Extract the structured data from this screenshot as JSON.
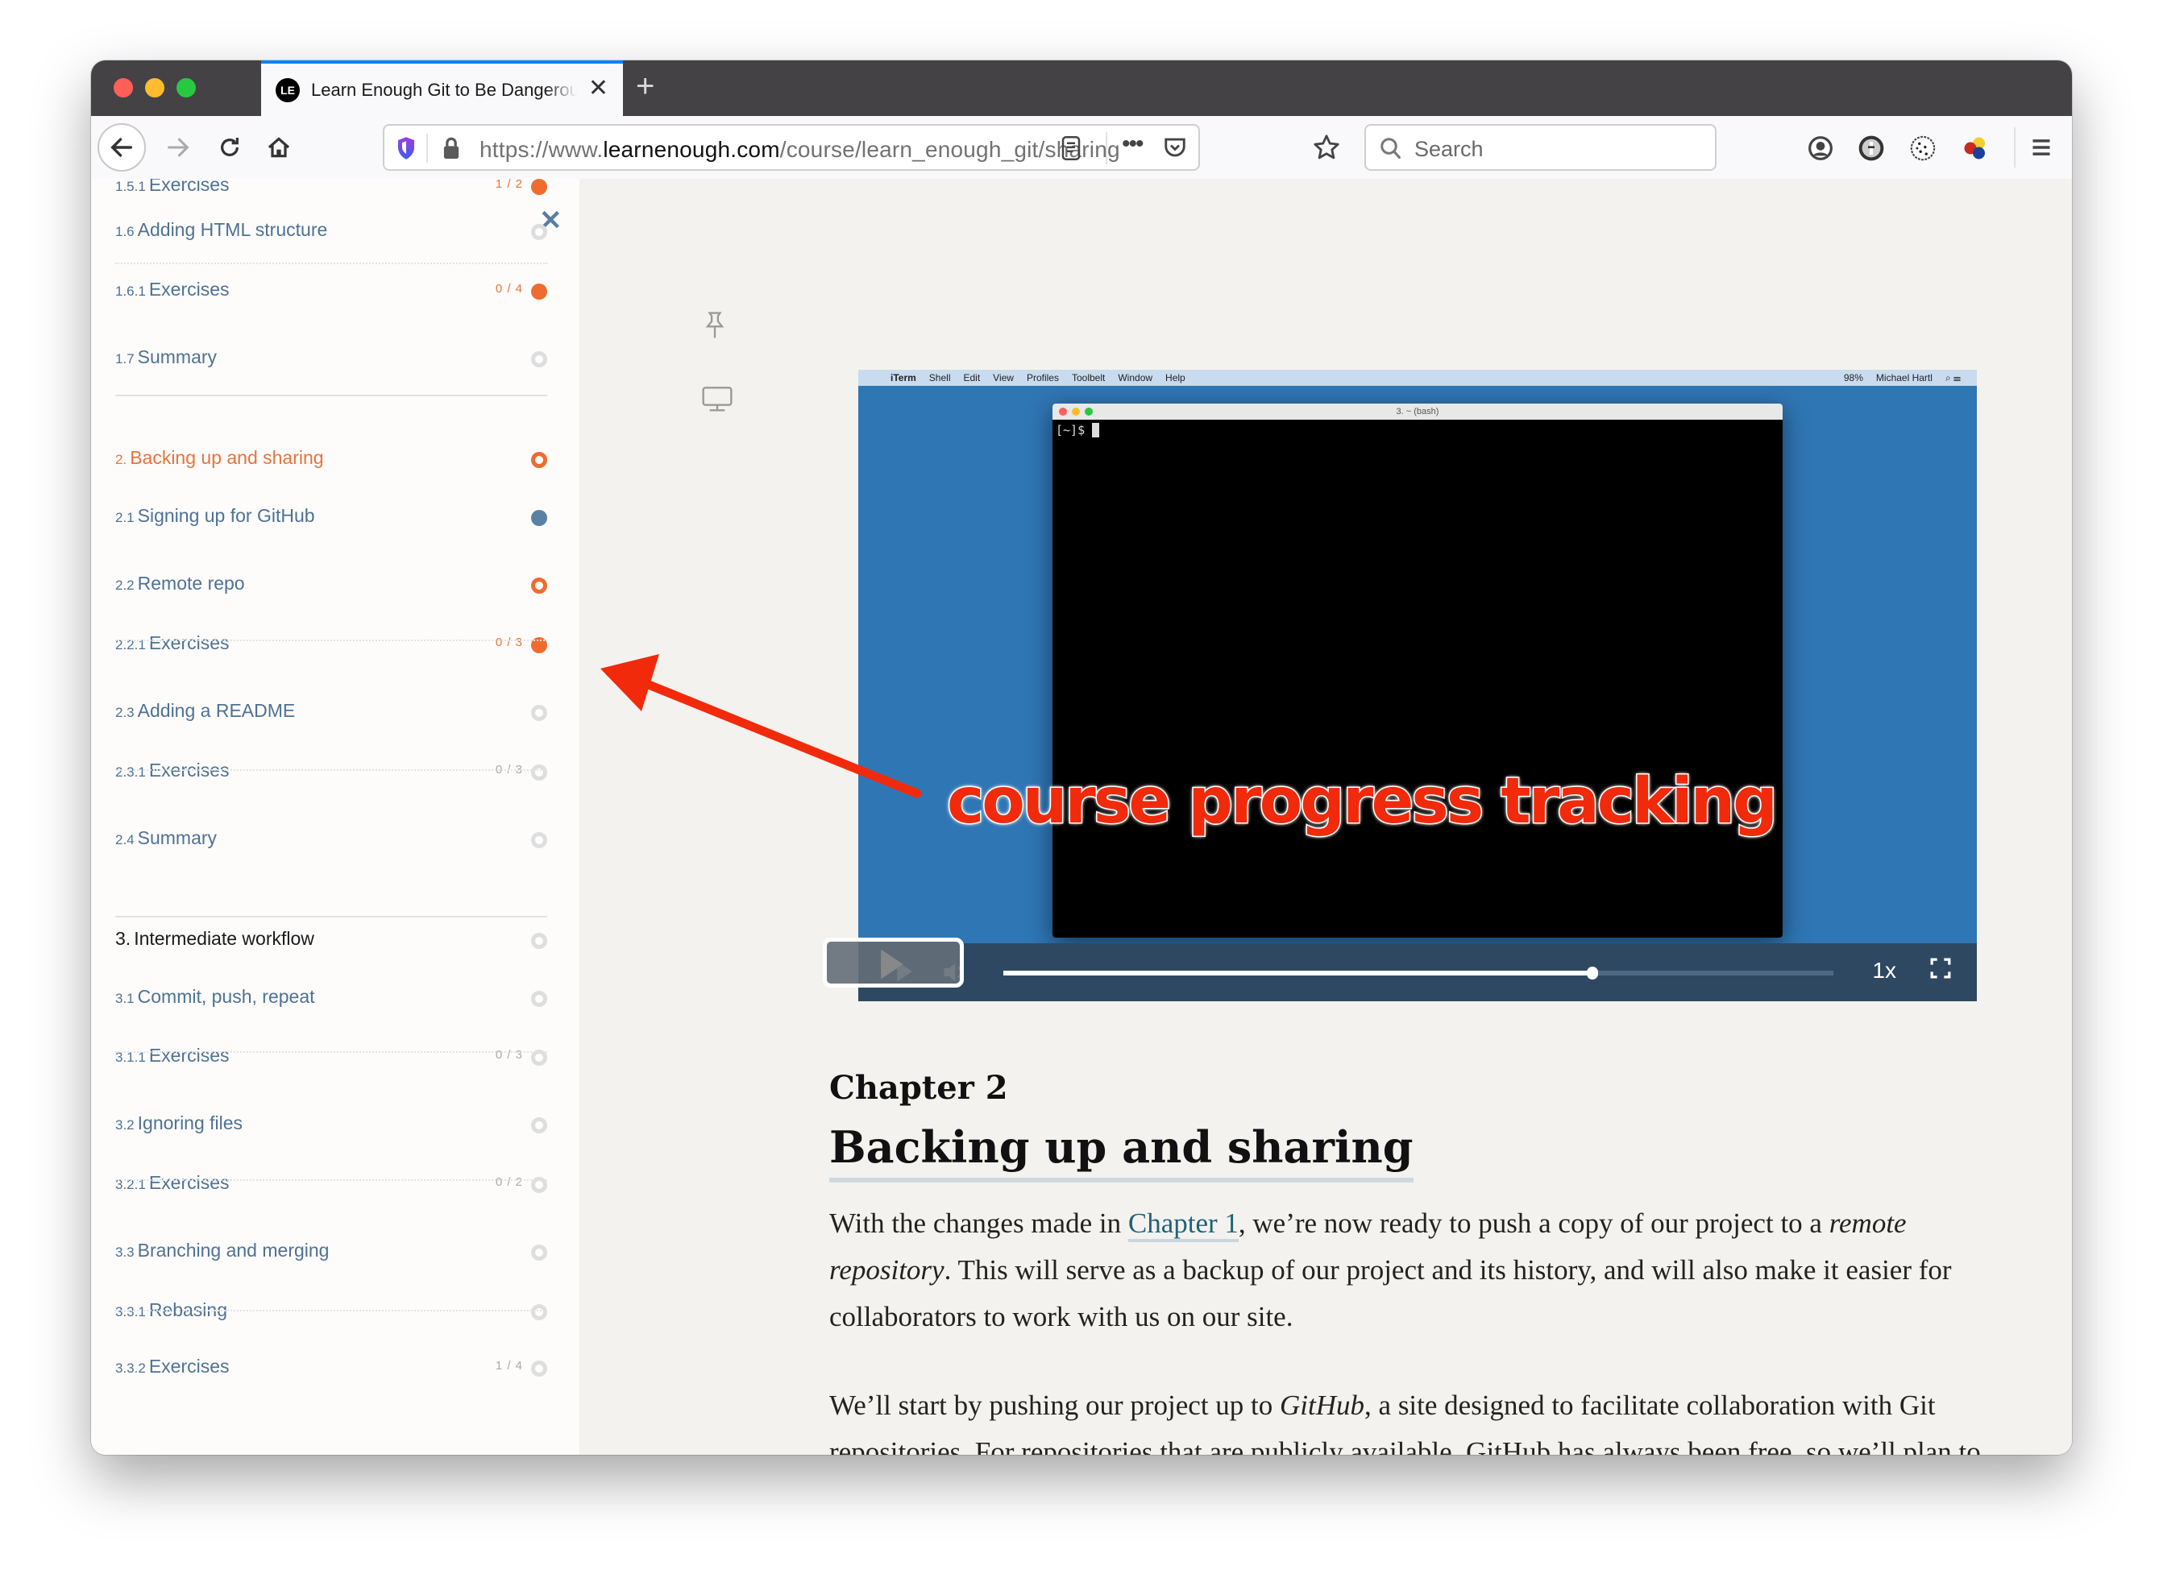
{
  "browser": {
    "tab_title": "Learn Enough Git to Be Dangerous",
    "tab_favicon": "LE",
    "url_prefix": "https://www.",
    "url_host": "learnenough.com",
    "url_path": "/course/learn_enough_git/sharing",
    "search_placeholder": "Search",
    "icons": [
      "back-icon",
      "forward-icon",
      "reload-icon",
      "home-icon",
      "shield-icon",
      "lock-icon",
      "reader-view-icon",
      "more-icon",
      "pocket-icon",
      "bookmark-star-icon",
      "search-icon",
      "account-icon",
      "password-icon",
      "cookie-icon",
      "extension-icon",
      "menu-icon"
    ]
  },
  "sidebar": {
    "close_label": "✕",
    "items": [
      {
        "num": "1.5.1",
        "label": "Exercises",
        "count": "1 / 2",
        "status": "partial"
      },
      {
        "num": "1.6",
        "label": "Adding HTML structure",
        "count": "",
        "status": "empty"
      },
      {
        "num": "1.6.1",
        "label": "Exercises",
        "count": "0 / 4",
        "status": "partial"
      },
      {
        "num": "1.7",
        "label": "Summary",
        "count": "",
        "status": "empty"
      },
      {
        "num": "2.",
        "label": "Backing up and sharing",
        "count": "",
        "status": "current"
      },
      {
        "num": "2.1",
        "label": "Signing up for GitHub",
        "count": "",
        "status": "done"
      },
      {
        "num": "2.2",
        "label": "Remote repo",
        "count": "",
        "status": "current"
      },
      {
        "num": "2.2.1",
        "label": "Exercises",
        "count": "0 / 3",
        "status": "partial"
      },
      {
        "num": "2.3",
        "label": "Adding a README",
        "count": "",
        "status": "empty"
      },
      {
        "num": "2.3.1",
        "label": "Exercises",
        "count": "0 / 3",
        "status": "empty"
      },
      {
        "num": "2.4",
        "label": "Summary",
        "count": "",
        "status": "empty"
      },
      {
        "num": "3.",
        "label": "Intermediate workflow",
        "count": "",
        "status": "empty"
      },
      {
        "num": "3.1",
        "label": "Commit, push, repeat",
        "count": "",
        "status": "empty"
      },
      {
        "num": "3.1.1",
        "label": "Exercises",
        "count": "0 / 3",
        "status": "empty"
      },
      {
        "num": "3.2",
        "label": "Ignoring files",
        "count": "",
        "status": "empty"
      },
      {
        "num": "3.2.1",
        "label": "Exercises",
        "count": "0 / 2",
        "status": "empty"
      },
      {
        "num": "3.3",
        "label": "Branching and merging",
        "count": "",
        "status": "empty"
      },
      {
        "num": "3.3.1",
        "label": "Rebasing",
        "count": "",
        "status": "empty"
      },
      {
        "num": "3.3.2",
        "label": "Exercises",
        "count": "1 / 4",
        "status": "empty"
      }
    ]
  },
  "video": {
    "menubar": [
      "iTerm",
      "Shell",
      "Edit",
      "View",
      "Profiles",
      "Toolbelt",
      "Window",
      "Help"
    ],
    "menubar_right": {
      "battery": "98%",
      "user": "Michael Hartl"
    },
    "terminal_title": "3. ~ (bash)",
    "prompt": "[~]$",
    "progress": 0.71,
    "speed": "1x"
  },
  "content": {
    "chapter_label": "Chapter 2",
    "chapter_title": "Backing up and sharing",
    "p1_a": "With the changes made in ",
    "p1_link": "Chapter 1",
    "p1_b": ", we’re now ready to push a copy of our project to a ",
    "p1_em": "remote repository",
    "p1_c": ".  This will serve as a backup of our project and its history, and will also make it easier for collaborators to work with us on our site.",
    "p2_a": "We’ll start by pushing our project up to ",
    "p2_em": "GitHub",
    "p2_b": ", a site designed to facilitate collaboration with Git repositories.  For repositories that are publicly available, GitHub has always been free, so we’ll plan to make our website’s repo public to take advantage of this.  (When this tutorial was first"
  },
  "annotation": {
    "text": "course progress tracking",
    "color": "#f22a0c"
  },
  "colors": {
    "accent_orange": "#ef6c2f",
    "link_blue": "#4e7295",
    "video_blue": "#2f76b4"
  }
}
